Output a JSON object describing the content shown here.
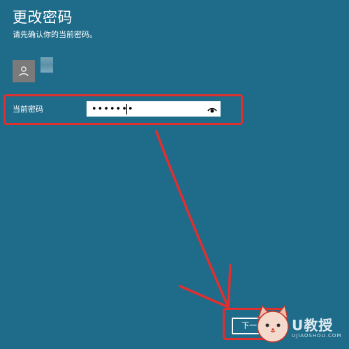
{
  "header": {
    "title": "更改密码",
    "subtitle": "请先确认你的当前密码。"
  },
  "account": {
    "avatar_icon": "user-icon"
  },
  "password": {
    "label": "当前密码",
    "value": "•••••••",
    "reveal_icon": "eye-icon"
  },
  "footer": {
    "next_label": "下一"
  },
  "colors": {
    "background": "#1e6b8a",
    "annotation": "#e02f2f"
  }
}
